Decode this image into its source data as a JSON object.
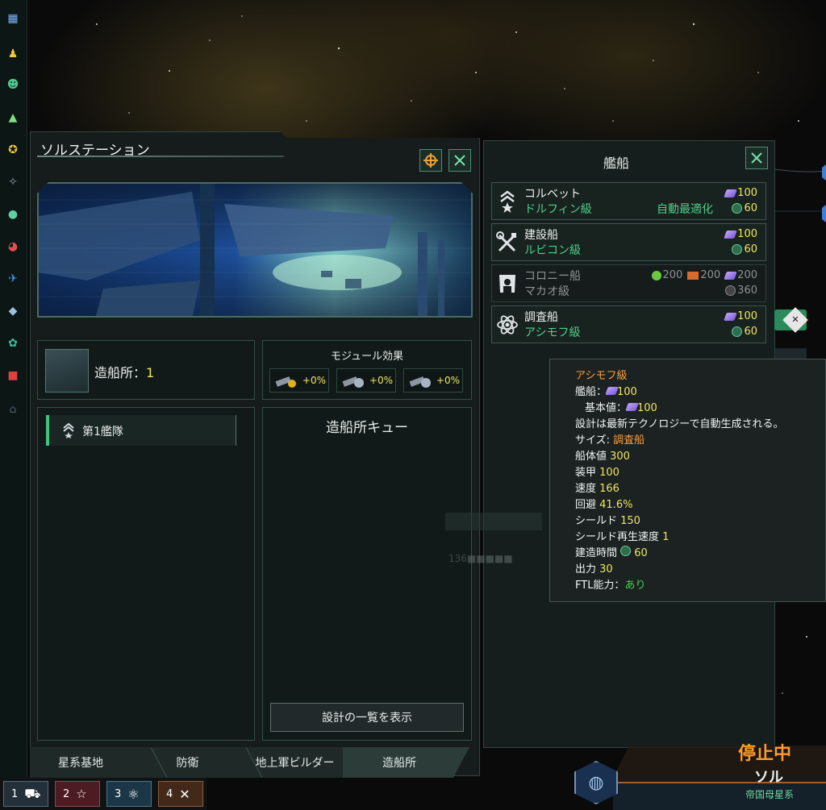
{
  "left_panel": {
    "title": "ソルステーション",
    "shipyard": {
      "label": "造船所：",
      "value": "1"
    },
    "modules": {
      "title": "モジュール効果",
      "items": [
        {
          "icon": "cannon-credits-icon",
          "value": "+0%"
        },
        {
          "icon": "cannon-gauge-icon",
          "value": "+0%"
        },
        {
          "icon": "cannon-speed-icon",
          "value": "+0%"
        }
      ]
    },
    "fleet": {
      "label": "第1艦隊",
      "icon": "fleet-rank-icon"
    },
    "queue": {
      "title": "造船所キュー"
    },
    "show_designs": "設計の一覧を表示",
    "tabs": [
      "星系基地",
      "防衛",
      "地上軍ビルダー",
      "造船所"
    ]
  },
  "ships_panel": {
    "title": "艦船",
    "ships": [
      {
        "name": "コルベット",
        "class": "ドルフィン級",
        "note": "自動最適化",
        "alloys": "100",
        "time": "60",
        "icon": "corvette-icon",
        "enabled": true
      },
      {
        "name": "建設船",
        "class": "ルビコン級",
        "note": "",
        "alloys": "100",
        "time": "60",
        "icon": "construction-icon",
        "enabled": true
      },
      {
        "name": "コロニー船",
        "class": "マカオ級",
        "food": "200",
        "consumer_goods": "200",
        "alloys": "200",
        "time": "360",
        "icon": "colony-icon",
        "enabled": false
      },
      {
        "name": "調査船",
        "class": "アシモフ級",
        "note": "",
        "alloys": "100",
        "time": "60",
        "icon": "science-icon",
        "enabled": true
      }
    ]
  },
  "tooltip": {
    "title": "アシモフ級",
    "cost_label": "艦船：",
    "cost_value": "100",
    "base_label": "基本値：",
    "base_value": "100",
    "desc": "設計は最新テクノロジーで自動生成される。",
    "size_label": "サイズ: ",
    "size_value": "調査船",
    "hull_label": "船体値 ",
    "hull_value": "300",
    "armor_label": "装甲 ",
    "armor_value": "100",
    "speed_label": "速度 ",
    "speed_value": "166",
    "evasion_label": "回避 ",
    "evasion_value": "41.6%",
    "shield_label": "シールド ",
    "shield_value": "150",
    "shield_regen_label": "シールド再生速度 ",
    "shield_regen_value": "1",
    "build_label": "建造時間 ",
    "build_value": "60",
    "power_label": "出力 ",
    "power_value": "30",
    "ftl_label": "FTL能力：",
    "ftl_value": "あり"
  },
  "background": {
    "ghost_text": "136■■■■■"
  },
  "fleet_bar": [
    {
      "num": "1",
      "color": "#2a3a45"
    },
    {
      "num": "2",
      "color": "#5a1e24"
    },
    {
      "num": "3",
      "color": "#1e3a4a"
    },
    {
      "num": "4",
      "color": "#4a2e1a"
    }
  ],
  "status": {
    "paused": "停止中",
    "system": "ソル",
    "subtitle": "帝国母星系"
  }
}
